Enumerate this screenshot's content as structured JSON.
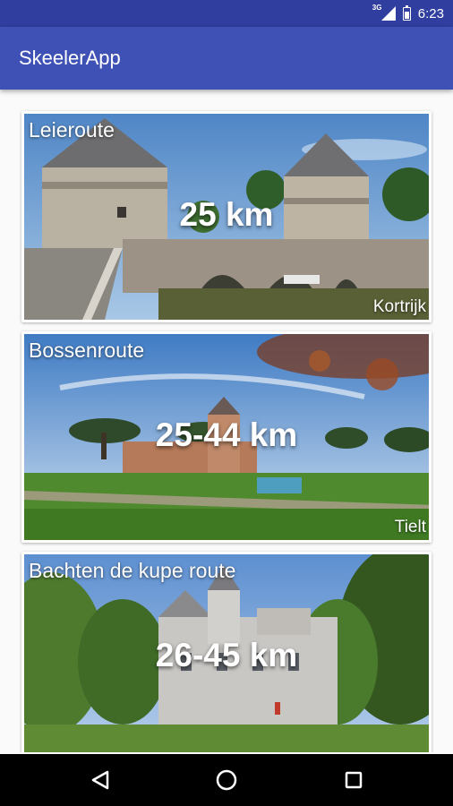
{
  "status_bar": {
    "network": "3G",
    "time": "6:23"
  },
  "app_bar": {
    "title": "SkeelerApp"
  },
  "routes": [
    {
      "name": "Leieroute",
      "distance": "25 km",
      "city": "Kortrijk"
    },
    {
      "name": "Bossenroute",
      "distance": "25-44 km",
      "city": "Tielt"
    },
    {
      "name": "Bachten de kupe route",
      "distance": "26-45 km",
      "city": ""
    }
  ],
  "nav_bar": {
    "back": "back-icon",
    "home": "home-icon",
    "recents": "recents-icon"
  },
  "colors": {
    "status_bar": "#303f9f",
    "app_bar": "#3f51b5",
    "background": "#fafafa"
  }
}
